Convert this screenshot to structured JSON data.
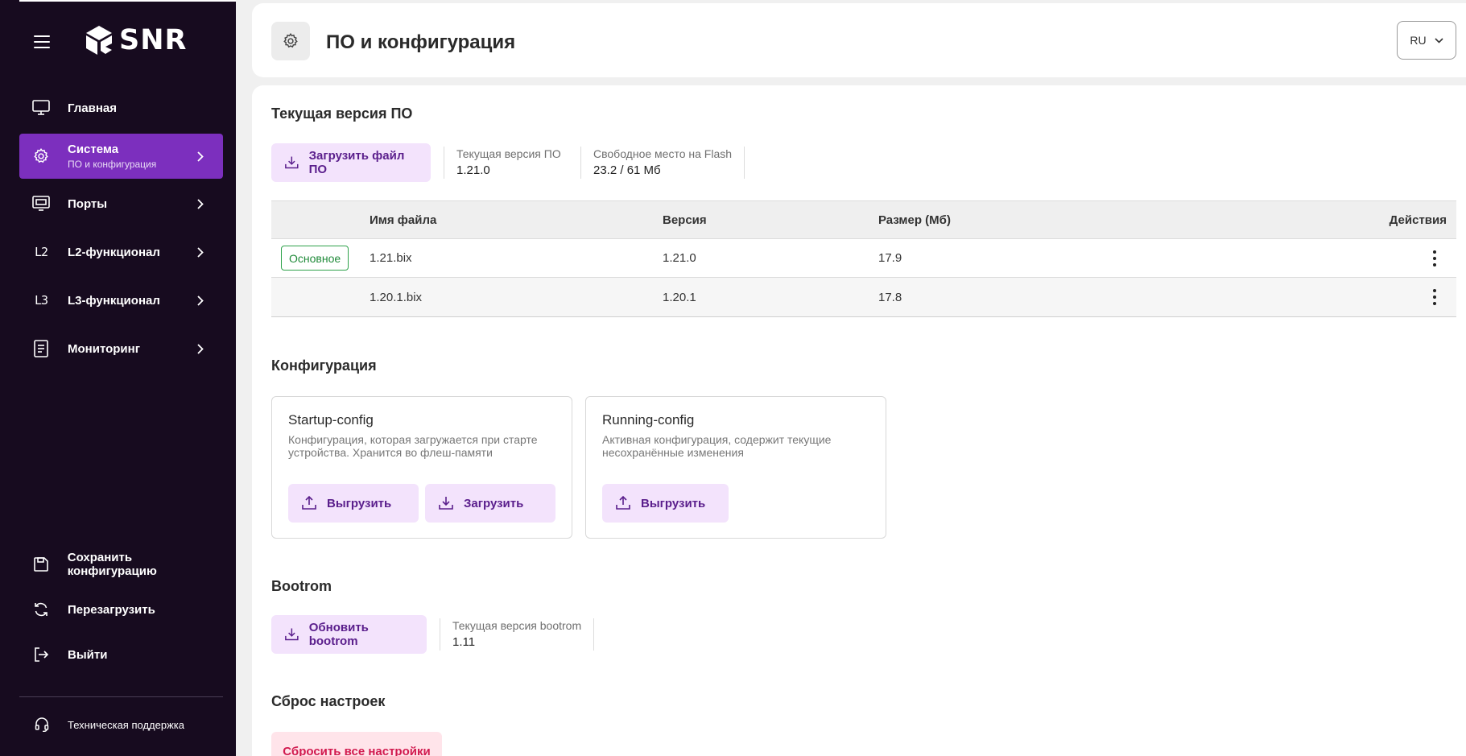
{
  "app": {
    "logo_text": "SNR"
  },
  "sidebar": {
    "items": [
      {
        "label": "Главная"
      },
      {
        "label": "Система",
        "sub": "ПО и конфигурация"
      },
      {
        "label": "Порты"
      },
      {
        "label": "L2-функционал",
        "icon_text": "L2"
      },
      {
        "label": "L3-функционал",
        "icon_text": "L3"
      },
      {
        "label": "Мониторинг"
      }
    ],
    "actions": [
      {
        "label": "Сохранить конфигурацию"
      },
      {
        "label": "Перезагрузить"
      },
      {
        "label": "Выйти"
      }
    ],
    "support_label": "Техническая поддержка"
  },
  "header": {
    "title": "ПО и конфигурация",
    "language": "RU"
  },
  "firmware": {
    "section_title": "Текущая версия ПО",
    "upload_button": "Загрузить файл ПО",
    "current_version_label": "Текущая версия ПО",
    "current_version_value": "1.21.0",
    "flash_label": "Свободное место на Flash",
    "flash_value": "23.2 / 61 Мб",
    "table": {
      "columns": [
        "Имя файла",
        "Версия",
        "Размер (Мб)",
        "Действия"
      ],
      "rows": [
        {
          "badge": "Основное",
          "file": "1.21.bix",
          "version": "1.21.0",
          "size": "17.9"
        },
        {
          "badge": "",
          "file": "1.20.1.bix",
          "version": "1.20.1",
          "size": "17.8"
        }
      ]
    }
  },
  "configuration": {
    "section_title": "Конфигурация",
    "startup": {
      "title": "Startup-config",
      "description": "Конфигурация, которая загружается при старте устройства. Хранится во флеш-памяти",
      "export_button": "Выгрузить",
      "import_button": "Загрузить"
    },
    "running": {
      "title": "Running-config",
      "description": "Активная конфигурация, содержит текущие несохранённые изменения",
      "export_button": "Выгрузить"
    }
  },
  "bootrom": {
    "section_title": "Bootrom",
    "update_button": "Обновить bootrom",
    "current_label": "Текущая версия bootrom",
    "current_value": "1.11"
  },
  "reset": {
    "section_title": "Сброс настроек",
    "reset_button": "Сбросить все настройки"
  },
  "colors": {
    "sidebar_bg": "#170b1f",
    "active_nav": "#7c2fbe",
    "soft_button": "#f3e3fc",
    "soft_button_text": "#5a1e8c",
    "badge_green": "#2ea24b",
    "danger_text": "#d1194e"
  }
}
